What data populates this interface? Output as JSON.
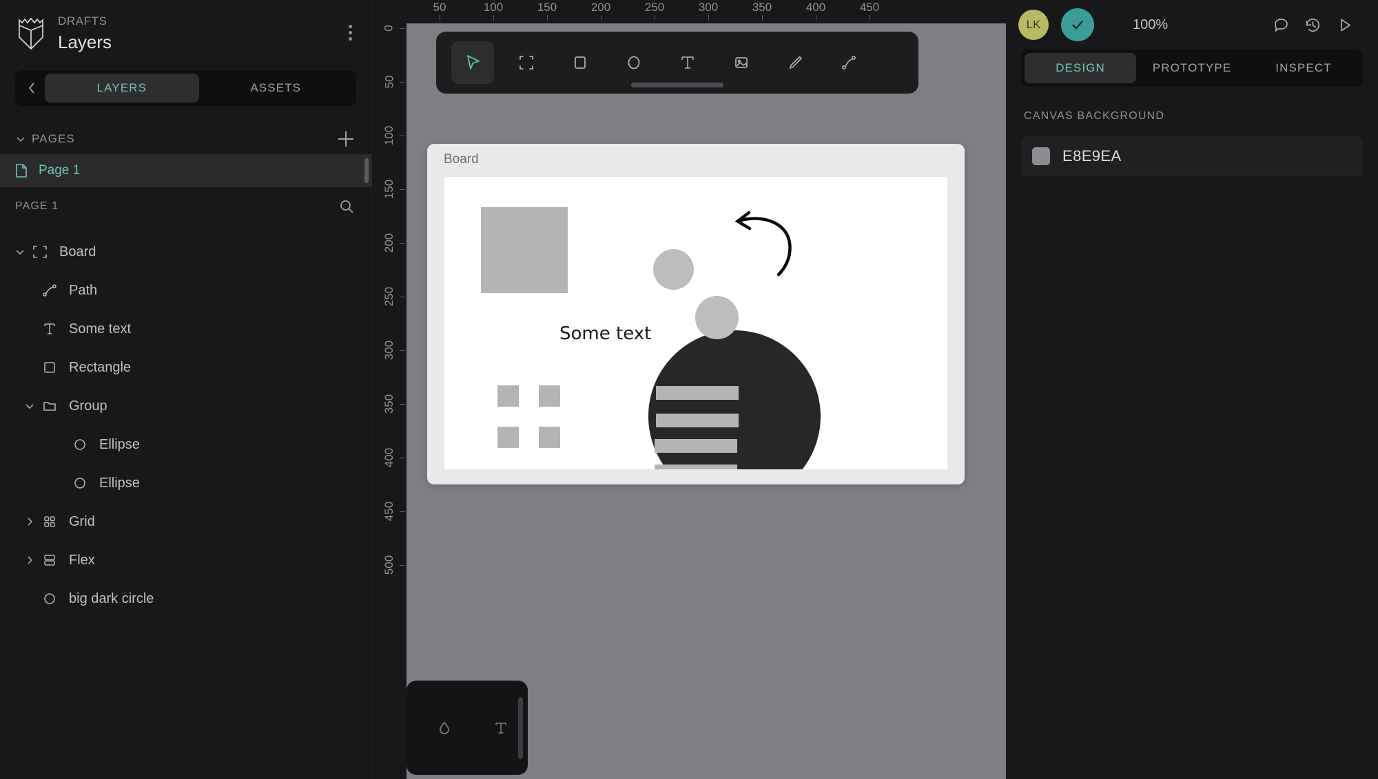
{
  "sidebar": {
    "project_label": "DRAFTS",
    "file_title": "Layers",
    "logo_icon": "penpot-logo-icon",
    "menu_icon": "kebab-menu-icon",
    "back_icon": "chevron-left-icon",
    "tabs": [
      {
        "label": "LAYERS",
        "active": true
      },
      {
        "label": "ASSETS",
        "active": false
      }
    ],
    "pages_section": {
      "title": "PAGES",
      "caret_icon": "chevron-down-icon",
      "add_icon": "plus-icon",
      "pages": [
        {
          "label": "Page 1",
          "icon": "page-icon",
          "selected": true
        }
      ]
    },
    "page_subheader": {
      "label": "PAGE 1",
      "search_icon": "search-icon"
    },
    "layers": [
      {
        "label": "Board",
        "icon": "board-icon",
        "twisty": "chevron-down",
        "indent": 0
      },
      {
        "label": "Path",
        "icon": "path-icon",
        "twisty": "none",
        "indent": 1
      },
      {
        "label": "Some text",
        "icon": "text-icon",
        "twisty": "none",
        "indent": 1
      },
      {
        "label": "Rectangle",
        "icon": "rectangle-icon",
        "twisty": "none",
        "indent": 1
      },
      {
        "label": "Group",
        "icon": "folder-icon",
        "twisty": "chevron-down",
        "indent": 1
      },
      {
        "label": "Ellipse",
        "icon": "ellipse-icon",
        "twisty": "none",
        "indent": 2
      },
      {
        "label": "Ellipse",
        "icon": "ellipse-icon",
        "twisty": "none",
        "indent": 2
      },
      {
        "label": "Grid",
        "icon": "grid-icon",
        "twisty": "chevron-right",
        "indent": 1
      },
      {
        "label": "Flex",
        "icon": "flex-icon",
        "twisty": "chevron-right",
        "indent": 1
      },
      {
        "label": "big dark circle",
        "icon": "ellipse-icon",
        "twisty": "none",
        "indent": 1
      }
    ]
  },
  "rulers": {
    "horizontal": [
      {
        "label": "50",
        "pos": 48
      },
      {
        "label": "100",
        "pos": 126
      },
      {
        "label": "150",
        "pos": 204
      },
      {
        "label": "200",
        "pos": 282
      },
      {
        "label": "250",
        "pos": 360
      },
      {
        "label": "300",
        "pos": 438
      },
      {
        "label": "350",
        "pos": 516
      },
      {
        "label": "400",
        "pos": 594
      },
      {
        "label": "450",
        "pos": 672
      }
    ],
    "vertical": [
      {
        "label": "0",
        "pos": 7
      },
      {
        "label": "50",
        "pos": 85
      },
      {
        "label": "100",
        "pos": 163
      },
      {
        "label": "150",
        "pos": 241
      },
      {
        "label": "200",
        "pos": 319
      },
      {
        "label": "250",
        "pos": 397
      },
      {
        "label": "300",
        "pos": 475
      },
      {
        "label": "350",
        "pos": 553
      },
      {
        "label": "400",
        "pos": 631
      },
      {
        "label": "450",
        "pos": 709
      },
      {
        "label": "500",
        "pos": 787
      }
    ]
  },
  "toolbar": {
    "tools": [
      {
        "name": "move-tool",
        "icon": "cursor-icon",
        "active": true
      },
      {
        "name": "board-tool",
        "icon": "board-icon",
        "active": false
      },
      {
        "name": "rectangle-tool",
        "icon": "rectangle-icon",
        "active": false
      },
      {
        "name": "ellipse-tool",
        "icon": "ellipse-icon",
        "active": false
      },
      {
        "name": "text-tool",
        "icon": "text-icon",
        "active": false
      },
      {
        "name": "image-tool",
        "icon": "image-icon",
        "active": false
      },
      {
        "name": "pencil-tool",
        "icon": "pencil-icon",
        "active": false
      },
      {
        "name": "path-tool",
        "icon": "path-icon",
        "active": false
      }
    ]
  },
  "palette": {
    "buttons": [
      {
        "name": "color-palette-button",
        "icon": "droplet-icon"
      },
      {
        "name": "typography-palette-button",
        "icon": "text-icon"
      }
    ]
  },
  "canvas": {
    "board_label": "Board",
    "text_element": "Some text",
    "background_color": "#7d7f82",
    "board_color": "#e8e9ea",
    "board_canvas_color": "#ffffff"
  },
  "topbar": {
    "avatar_initials": "LK",
    "avatar_color": "#b6bb63",
    "check_icon": "check-icon",
    "check_color": "#3a9e96",
    "zoom_level": "100%",
    "comment_icon": "comment-icon",
    "history_icon": "history-icon",
    "play_icon": "play-icon"
  },
  "right_panel": {
    "tabs": [
      {
        "label": "DESIGN",
        "active": true
      },
      {
        "label": "PROTOTYPE",
        "active": false
      },
      {
        "label": "INSPECT",
        "active": false
      }
    ],
    "canvas_background": {
      "section_title": "CANVAS BACKGROUND",
      "hex": "E8E9EA",
      "swatch_color": "#8b8d90"
    }
  }
}
